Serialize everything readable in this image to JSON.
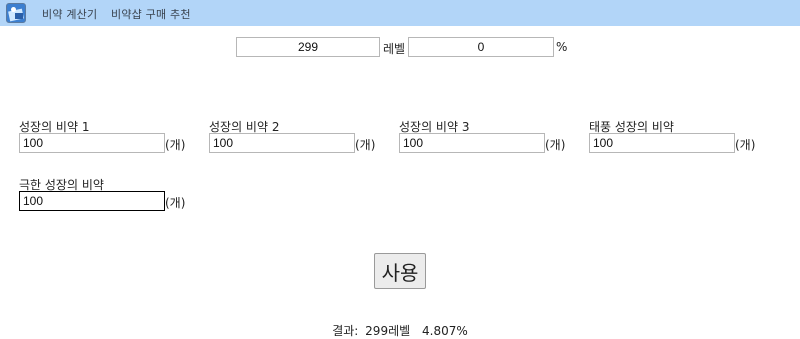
{
  "nav": {
    "items": [
      {
        "label": "비약 계산기"
      },
      {
        "label": "비약샵 구매 추천"
      }
    ]
  },
  "level_row": {
    "level_value": "299",
    "level_label": "레벨",
    "percent_value": "0",
    "percent_label": "%"
  },
  "potions": [
    {
      "label": "성장의 비약 1",
      "value": "100",
      "unit": "(개)"
    },
    {
      "label": "성장의 비약 2",
      "value": "100",
      "unit": "(개)"
    },
    {
      "label": "성장의 비약 3",
      "value": "100",
      "unit": "(개)"
    },
    {
      "label": "태풍 성장의 비약",
      "value": "100",
      "unit": "(개)"
    },
    {
      "label": "극한 성장의 비약",
      "value": "100",
      "unit": "(개)"
    }
  ],
  "use_button": {
    "label": "사용"
  },
  "result": {
    "prefix": "결과:",
    "level": "299레벨",
    "percent": "4.807%"
  }
}
